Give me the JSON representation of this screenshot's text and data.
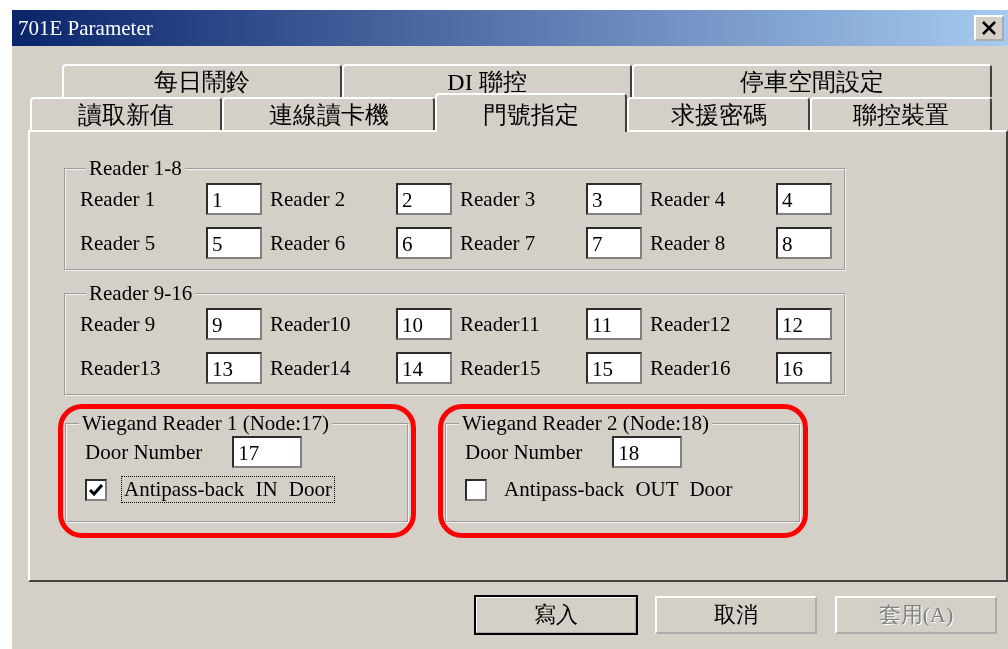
{
  "window": {
    "title": "701E Parameter"
  },
  "tab_rows": [
    [
      {
        "label": "每日鬧鈴",
        "selected": false
      },
      {
        "label": "DI 聯控",
        "selected": false
      },
      {
        "label": "停車空間設定",
        "selected": false
      }
    ],
    [
      {
        "label": "讀取新值",
        "selected": false
      },
      {
        "label": "連線讀卡機",
        "selected": false
      },
      {
        "label": "門號指定",
        "selected": true
      },
      {
        "label": "求援密碼",
        "selected": false
      },
      {
        "label": "聯控裝置",
        "selected": false
      }
    ]
  ],
  "groups": [
    {
      "title": "Reader 1-8",
      "fields": [
        {
          "label": "Reader 1",
          "value": "1"
        },
        {
          "label": "Reader 2",
          "value": "2"
        },
        {
          "label": "Reader 3",
          "value": "3"
        },
        {
          "label": "Reader 4",
          "value": "4"
        },
        {
          "label": "Reader 5",
          "value": "5"
        },
        {
          "label": "Reader 6",
          "value": "6"
        },
        {
          "label": "Reader 7",
          "value": "7"
        },
        {
          "label": "Reader 8",
          "value": "8"
        }
      ]
    },
    {
      "title": "Reader 9-16",
      "fields": [
        {
          "label": "Reader 9",
          "value": "9"
        },
        {
          "label": "Reader10",
          "value": "10"
        },
        {
          "label": "Reader11",
          "value": "11"
        },
        {
          "label": "Reader12",
          "value": "12"
        },
        {
          "label": "Reader13",
          "value": "13"
        },
        {
          "label": "Reader14",
          "value": "14"
        },
        {
          "label": "Reader15",
          "value": "15"
        },
        {
          "label": "Reader16",
          "value": "16"
        }
      ]
    }
  ],
  "wiegand": [
    {
      "title": "Wiegand Reader 1 (Node:17)",
      "highlighted": true,
      "door_label": "Door Number",
      "door_value": "17",
      "checkbox": {
        "label": "Antipass-back IN Door",
        "checked": true,
        "focused": true
      }
    },
    {
      "title": "Wiegand Reader 2 (Node:18)",
      "highlighted": true,
      "door_label": "Door Number",
      "door_value": "18",
      "checkbox": {
        "label": "Antipass-back OUT Door",
        "checked": false,
        "focused": false
      }
    }
  ],
  "buttons": [
    {
      "label": "寫入",
      "default": true,
      "disabled": false
    },
    {
      "label": "取消",
      "default": false,
      "disabled": false
    },
    {
      "label": "套用(A)",
      "default": false,
      "disabled": true
    }
  ]
}
